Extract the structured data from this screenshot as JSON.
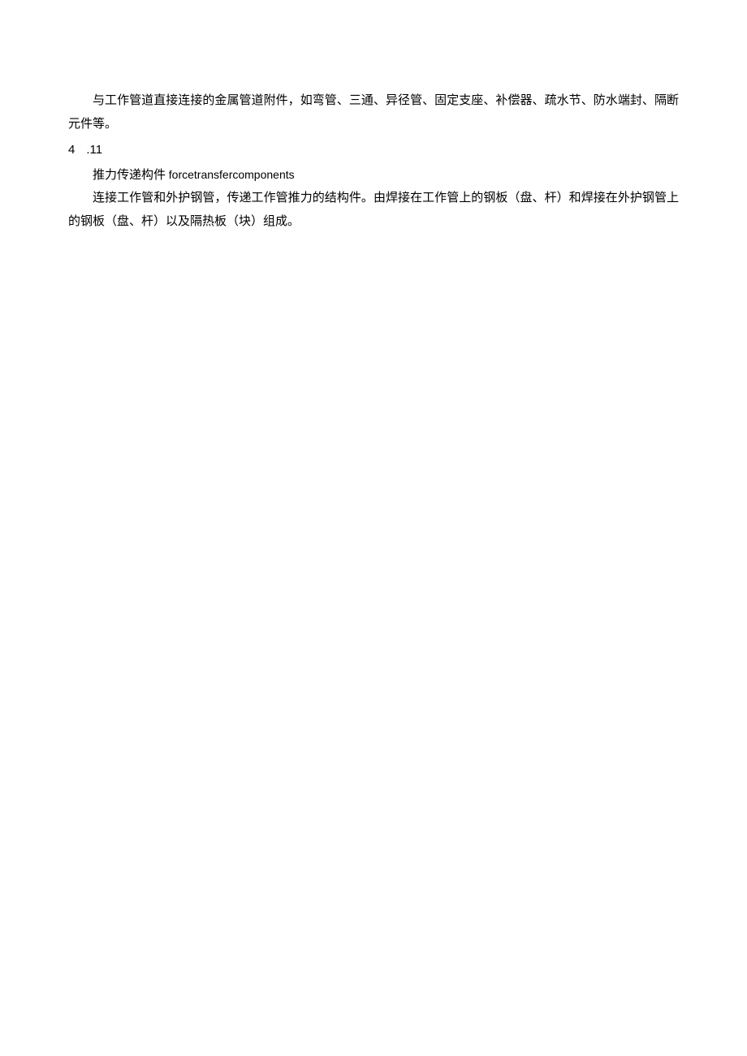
{
  "content": {
    "p1": "与工作管道直接连接的金属管道附件，如弯管、三通、异径管、固定支座、补偿器、疏水节、防水端封、隔断元件等。",
    "section_number_main": "4",
    "section_number_sub": ".11",
    "term_cn": "推力传递构件",
    "term_en": "forcetransfercomponents",
    "p2": "连接工作管和外护钢管，传递工作管推力的结构件。由焊接在工作管上的钢板（盘、杆）和焊接在外护钢管上的钢板（盘、杆）以及隔热板（块）组成。"
  }
}
